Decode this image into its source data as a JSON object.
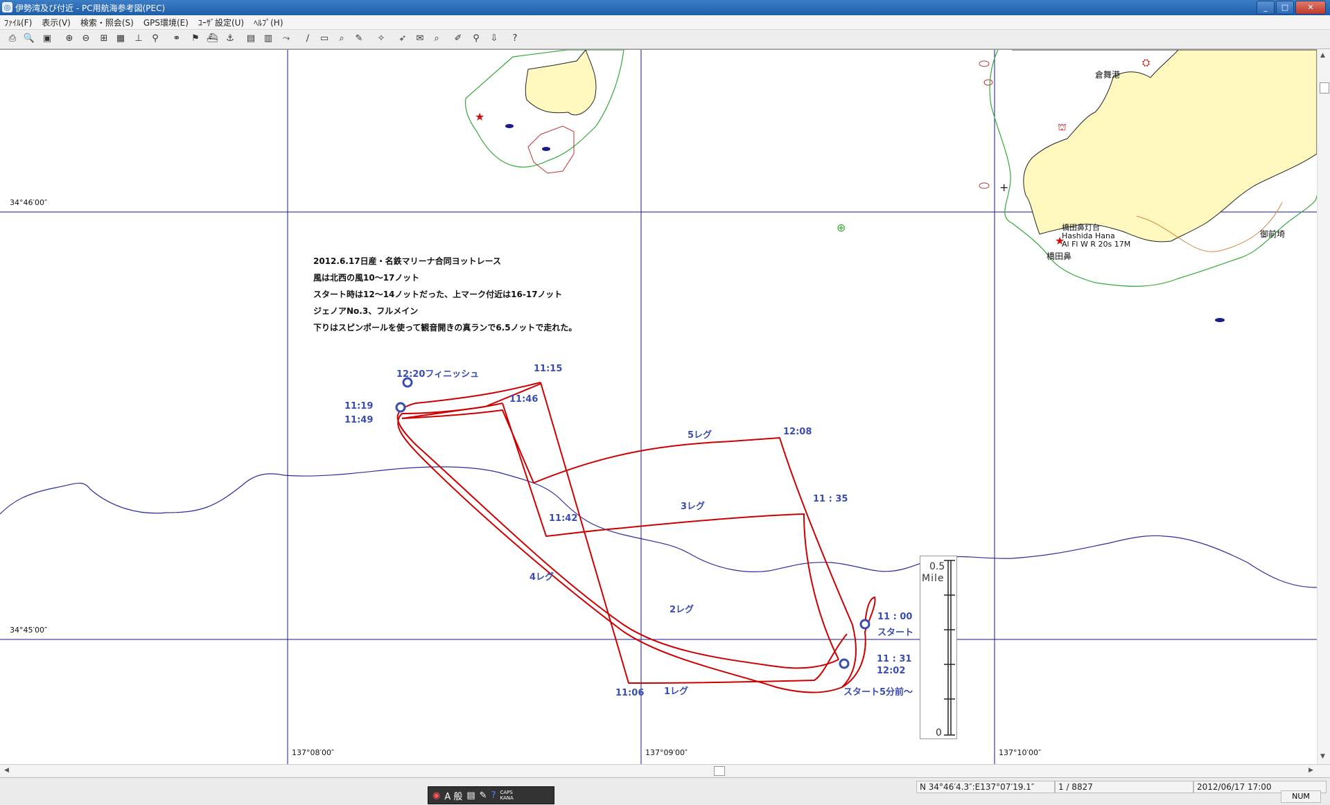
{
  "window": {
    "title": "伊勢湾及び付近 - PC用航海参考図(PEC)",
    "buttons": [
      "_",
      "□",
      "✕"
    ]
  },
  "menu": [
    "ﾌｧｲﾙ(F)",
    "表示(V)",
    "検索・照会(S)",
    "GPS環境(E)",
    "ﾕｰｻﾞ設定(U)",
    "ﾍﾙﾌﾟ(H)"
  ],
  "map": {
    "lat_labels": {
      "top": "34°46′00″",
      "bottom": "34°45′00″"
    },
    "lon_labels": [
      "137°08′00″",
      "137°09′00″",
      "137°10′00″"
    ],
    "places": {
      "port": "倉舞港",
      "lighthouse_name": "橋田鼻灯台",
      "lighthouse_romaji": "Hashida Hana",
      "lighthouse_light": "Al Fl W R 20s 17M",
      "cape": "橋田鼻",
      "temple": "御前埼"
    },
    "notes": [
      "2012.6.17日産・名鉄マリーナ合同ヨットレース",
      "風は北西の風10～17ノット",
      "スタート時は12～14ノットだった、上マーク付近は16-17ノット",
      "ジェノアNo.3、フルメイン",
      "下りはスピンポールを使って観音開きの真ランで6.5ノットで走れた。"
    ],
    "track_labels": {
      "finish": "12:20フィニッシュ",
      "t1115": "11:15",
      "t1146": "11:46",
      "t1119": "11:19",
      "t1149": "11:49",
      "leg5": "5レグ",
      "t1208": "12:08",
      "leg3": "3レグ",
      "t1135": "11 : 35",
      "t1142": "11:42",
      "leg4": "4レグ",
      "leg2": "2レグ",
      "t1100": "11 : 00",
      "start": "スタート",
      "t1131": "11 : 31",
      "t1202": "12:02",
      "t1106": "11:06",
      "leg1": "1レグ",
      "prestart": "スタート5分前～"
    },
    "scale": {
      "top": "0.5",
      "unit": "Mile",
      "bottom": "0"
    },
    "colors": {
      "track": "#cc0000",
      "grid": "#1a1a8a",
      "depth": "#2b2b9e",
      "label": "#3a4db0",
      "coast_green": "#34a83a",
      "land": "#fff8bf"
    }
  },
  "status": {
    "position": "N 34°46′4.3″:E137°07′19.1″",
    "page": "1 / 8827",
    "datetime": "2012/06/17 17:00",
    "num": "NUM"
  },
  "ime": {
    "mode": "A 般",
    "caps": "CAPS",
    "kana": "KANA"
  }
}
